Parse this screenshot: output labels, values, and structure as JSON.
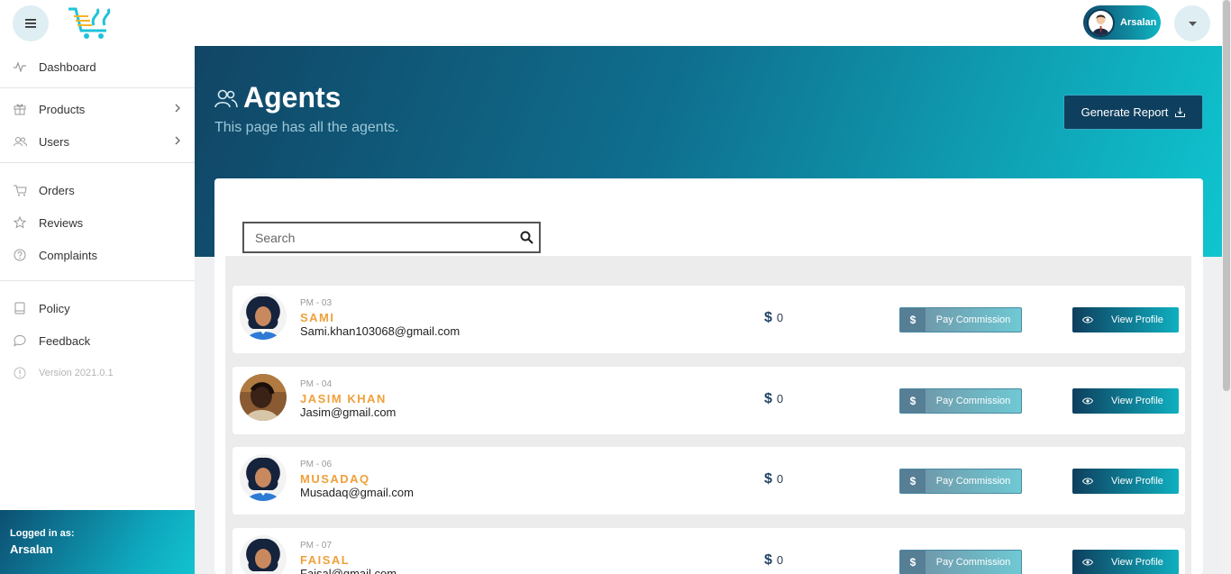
{
  "topbar": {
    "user_name": "Arsalan"
  },
  "sidebar": {
    "groups": [
      [
        {
          "label": "Dashboard",
          "icon": "pulse-icon"
        }
      ],
      [
        {
          "label": "Products",
          "icon": "gift-icon"
        },
        {
          "label": "Users",
          "icon": "users-icon"
        }
      ],
      [
        {
          "label": "Orders",
          "icon": "cart-icon"
        },
        {
          "label": "Reviews",
          "icon": "star-icon"
        },
        {
          "label": "Complaints",
          "icon": "question-icon"
        }
      ],
      [
        {
          "label": "Policy",
          "icon": "book-icon"
        },
        {
          "label": "Feedback",
          "icon": "chat-icon"
        },
        {
          "label": "Version 2021.0.1",
          "icon": "info-icon"
        }
      ]
    ],
    "logged_in_label": "Logged in as:",
    "logged_in_user": "Arsalan"
  },
  "header": {
    "title": "Agents",
    "subtitle": "This page has all the agents.",
    "generate_report": "Generate Report"
  },
  "search": {
    "placeholder": "Search"
  },
  "agents": [
    {
      "code": "PM - 03",
      "name": "SAMI",
      "email": "Sami.khan103068@gmail.com",
      "currency": "$",
      "amount": "0",
      "pay_label": "Pay Commission",
      "view_label": "View Profile",
      "avatar": "cartoon"
    },
    {
      "code": "PM - 04",
      "name": "JASIM KHAN",
      "email": "Jasim@gmail.com",
      "currency": "$",
      "amount": "0",
      "pay_label": "Pay Commission",
      "view_label": "View Profile",
      "avatar": "photo"
    },
    {
      "code": "PM - 06",
      "name": "MUSADAQ",
      "email": "Musadaq@gmail.com",
      "currency": "$",
      "amount": "0",
      "pay_label": "Pay Commission",
      "view_label": "View Profile",
      "avatar": "cartoon"
    },
    {
      "code": "PM - 07",
      "name": "FAISAL",
      "email": "Faisal@gmail.com",
      "currency": "$",
      "amount": "0",
      "pay_label": "Pay Commission",
      "view_label": "View Profile",
      "avatar": "cartoon"
    }
  ],
  "colors": {
    "accent": "#0fb5c4",
    "dark": "#0e3f5e",
    "name": "#f0a03a"
  }
}
